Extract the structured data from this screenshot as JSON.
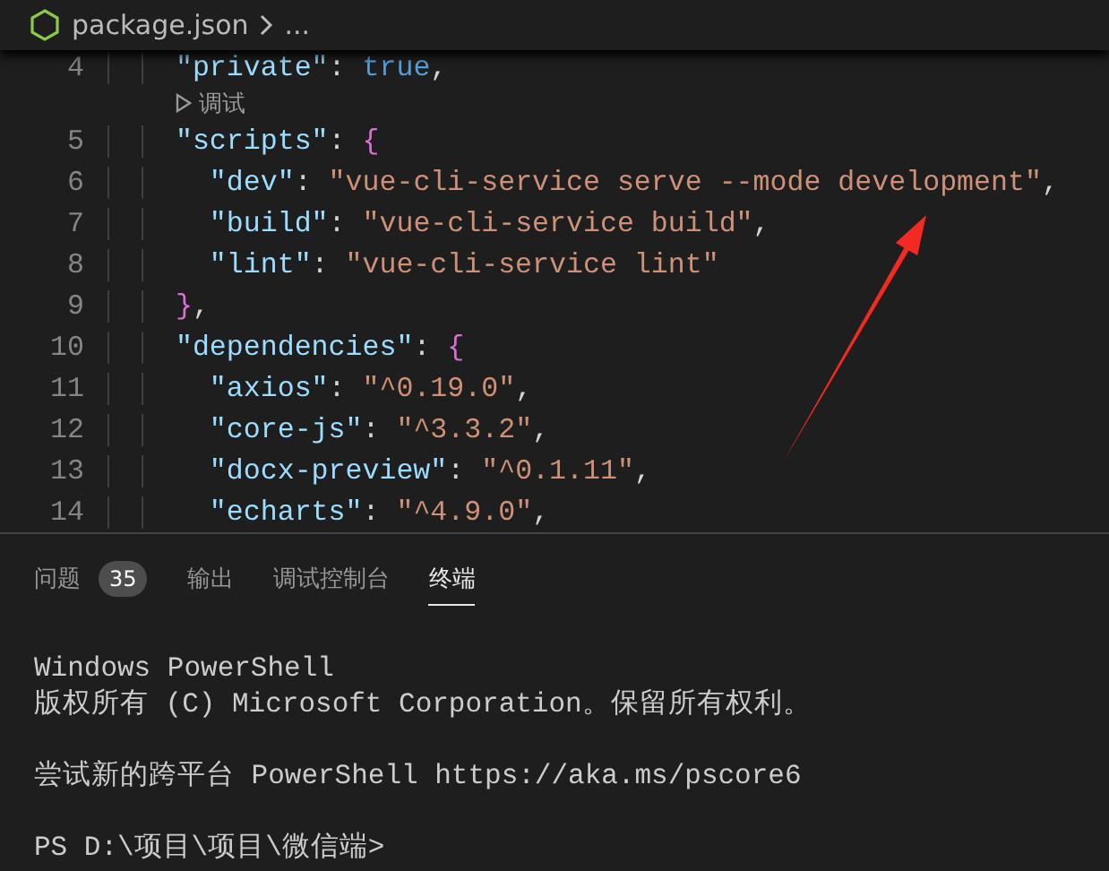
{
  "breadcrumb": {
    "file": "package.json",
    "more": "..."
  },
  "editor": {
    "lines": [
      {
        "number": "4",
        "tokens": [
          {
            "kind": "key",
            "text": "  \"private\""
          },
          {
            "kind": "punct",
            "text": ": "
          },
          {
            "kind": "keyword",
            "text": "true"
          },
          {
            "kind": "punct",
            "text": ","
          }
        ]
      },
      {
        "kind": "codelens",
        "label": "调试"
      },
      {
        "number": "5",
        "tokens": [
          {
            "kind": "key",
            "text": "  \"scripts\""
          },
          {
            "kind": "punct",
            "text": ": "
          },
          {
            "kind": "bracket",
            "text": "{"
          }
        ]
      },
      {
        "number": "6",
        "tokens": [
          {
            "kind": "key",
            "text": "    \"dev\""
          },
          {
            "kind": "punct",
            "text": ": "
          },
          {
            "kind": "string",
            "text": "\"vue-cli-service serve --mode development\""
          },
          {
            "kind": "punct",
            "text": ","
          }
        ]
      },
      {
        "number": "7",
        "tokens": [
          {
            "kind": "key",
            "text": "    \"build\""
          },
          {
            "kind": "punct",
            "text": ": "
          },
          {
            "kind": "string",
            "text": "\"vue-cli-service build\""
          },
          {
            "kind": "punct",
            "text": ","
          }
        ]
      },
      {
        "number": "8",
        "tokens": [
          {
            "kind": "key",
            "text": "    \"lint\""
          },
          {
            "kind": "punct",
            "text": ": "
          },
          {
            "kind": "string",
            "text": "\"vue-cli-service lint\""
          }
        ]
      },
      {
        "number": "9",
        "tokens": [
          {
            "kind": "bracket",
            "text": "  }"
          },
          {
            "kind": "punct",
            "text": ","
          }
        ]
      },
      {
        "number": "10",
        "tokens": [
          {
            "kind": "key",
            "text": "  \"dependencies\""
          },
          {
            "kind": "punct",
            "text": ": "
          },
          {
            "kind": "bracket",
            "text": "{"
          }
        ]
      },
      {
        "number": "11",
        "tokens": [
          {
            "kind": "key",
            "text": "    \"axios\""
          },
          {
            "kind": "punct",
            "text": ": "
          },
          {
            "kind": "string",
            "text": "\"^0.19.0\""
          },
          {
            "kind": "punct",
            "text": ","
          }
        ]
      },
      {
        "number": "12",
        "tokens": [
          {
            "kind": "key",
            "text": "    \"core-js\""
          },
          {
            "kind": "punct",
            "text": ": "
          },
          {
            "kind": "string",
            "text": "\"^3.3.2\""
          },
          {
            "kind": "punct",
            "text": ","
          }
        ]
      },
      {
        "number": "13",
        "tokens": [
          {
            "kind": "key",
            "text": "    \"docx-preview\""
          },
          {
            "kind": "punct",
            "text": ": "
          },
          {
            "kind": "string",
            "text": "\"^0.1.11\""
          },
          {
            "kind": "punct",
            "text": ","
          }
        ]
      },
      {
        "number": "14",
        "tokens": [
          {
            "kind": "key",
            "text": "    \"echarts\""
          },
          {
            "kind": "punct",
            "text": ": "
          },
          {
            "kind": "string",
            "text": "\"^4.9.0\""
          },
          {
            "kind": "punct",
            "text": ","
          }
        ]
      }
    ]
  },
  "panel": {
    "tabs": [
      {
        "label": "问题",
        "badge": "35",
        "selected": false
      },
      {
        "label": "输出",
        "selected": false
      },
      {
        "label": "调试控制台",
        "selected": false
      },
      {
        "label": "终端",
        "selected": true
      }
    ],
    "terminal": [
      [
        "Windows PowerShell",
        "版权所有 (C) Microsoft Corporation。保留所有权利。"
      ],
      [
        "尝试新的跨平台 PowerShell https://aka.ms/pscore6"
      ],
      [
        "PS D:\\项目\\项目\\微信端>"
      ]
    ]
  }
}
